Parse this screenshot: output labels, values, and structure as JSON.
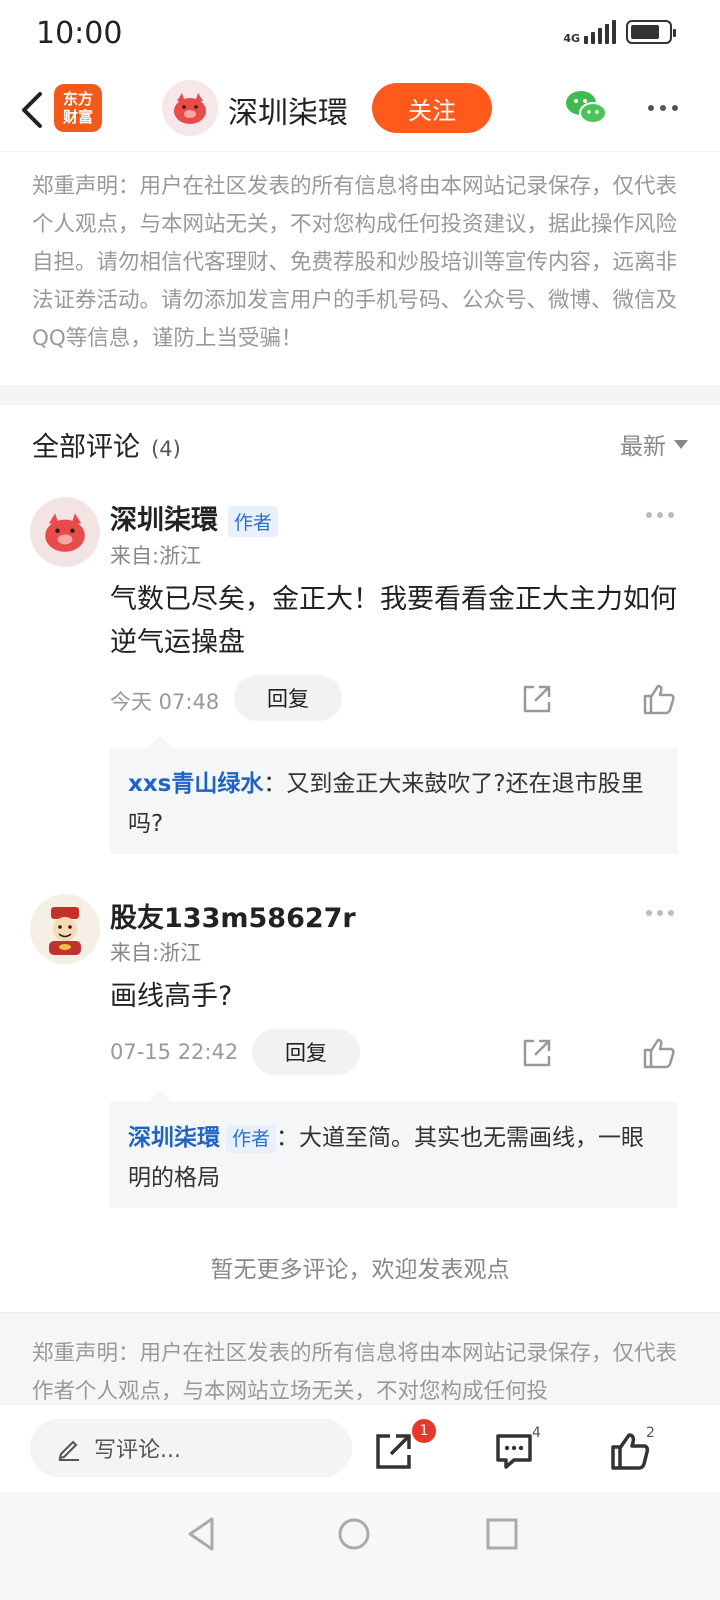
{
  "status_bar": {
    "time": "10:00",
    "network": "4G"
  },
  "nav": {
    "app_logo_text": "东方\n财富",
    "user_name": "深圳柒環",
    "follow_label": "关注"
  },
  "disclaimer_top": "郑重声明：用户在社区发表的所有信息将由本网站记录保存，仅代表个人观点，与本网站无关，不对您构成任何投资建议，据此操作风险自担。请勿相信代客理财、免费荐股和炒股培训等宣传内容，远离非法证券活动。请勿添加发言用户的手机号码、公众号、微博、微信及QQ等信息，谨防上当受骗！",
  "comments_header": {
    "title": "全部评论",
    "count": "(4)",
    "sort_label": "最新"
  },
  "comments": [
    {
      "user": "深圳柒環",
      "author_badge": "作者",
      "from": "来自:浙江",
      "text": "气数已尽矣，金正大！我要看看金正大主力如何逆气运操盘",
      "time": "今天 07:48",
      "reply_label": "回复",
      "reply": {
        "user": "xxs青山绿水",
        "text": "：又到金正大来鼓吹了?还在退市股里吗?"
      }
    },
    {
      "user": "股友133m58627r",
      "from": "来自:浙江",
      "text": "画线高手?",
      "time": "07-15 22:42",
      "reply_label": "回复",
      "reply": {
        "user": "深圳柒環",
        "badge": "作者",
        "text": "：大道至简。其实也无需画线，一眼明的格局"
      }
    }
  ],
  "no_more": "暂无更多评论，欢迎发表观点",
  "disclaimer_bottom": "郑重声明：用户在社区发表的所有信息将由本网站记录保存，仅代表作者个人观点，与本网站立场无关，不对您构成任何投",
  "bottom_bar": {
    "write_placeholder": "写评论...",
    "share_badge": "1",
    "comment_count": "4",
    "like_count": "2"
  },
  "colors": {
    "accent": "#ff5a1c",
    "link_blue": "#1f63c4",
    "badge_red": "#e9362b"
  }
}
